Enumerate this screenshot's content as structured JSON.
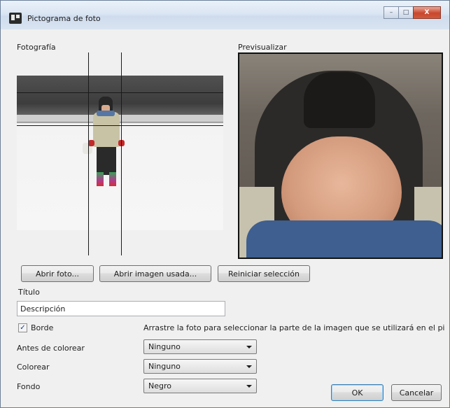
{
  "window": {
    "title": "Pictograma de foto"
  },
  "caption": {
    "minimize": "–",
    "maximize": "□",
    "close": "X"
  },
  "labels": {
    "photo": "Fotografía",
    "preview": "Previsualizar",
    "title": "Título",
    "border": "Borde",
    "before_color": "Antes de colorear",
    "color": "Colorear",
    "background": "Fondo",
    "hint": "Arrastre la foto para seleccionar la parte de la imagen que se utilizará en el pi"
  },
  "buttons": {
    "open_photo": "Abrir foto...",
    "open_used": "Abrir imagen usada...",
    "reset": "Reiniciar selección",
    "ok": "OK",
    "cancel": "Cancelar"
  },
  "inputs": {
    "description": "Descripción",
    "border_checked": "✓"
  },
  "selects": {
    "before_color": "Ninguno",
    "color": "Ninguno",
    "background": "Negro"
  }
}
